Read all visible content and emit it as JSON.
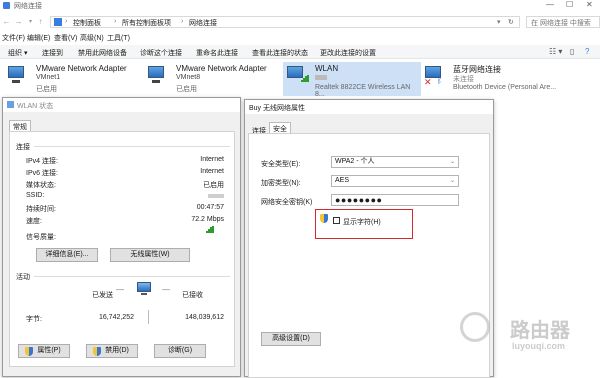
{
  "window": {
    "title": "网络连接"
  },
  "address": {
    "crumbs": [
      "控制面板",
      "所有控制面板项",
      "网络连接"
    ],
    "search_placeholder": "在 网络连接 中搜索"
  },
  "menu": [
    "文件(F)",
    "编辑(E)",
    "查看(V)",
    "高级(N)",
    "工具(T)"
  ],
  "commands": [
    "组织 ▾",
    "连接到",
    "禁用此网络设备",
    "诊断这个连接",
    "重命名此连接",
    "查看此连接的状态",
    "更改此连接的设置"
  ],
  "adapters": [
    {
      "name": "VMware Network Adapter",
      "sub": "VMnet1",
      "status": "已启用"
    },
    {
      "name": "VMware Network Adapter",
      "sub": "VMnet8",
      "status": "已启用"
    },
    {
      "name": "WLAN",
      "sub": "",
      "status": "Realtek 8822CE Wireless LAN 8..."
    },
    {
      "name": "蓝牙网络连接",
      "sub": "未连接",
      "status": "Bluetooth Device (Personal Are..."
    }
  ],
  "wlan_status": {
    "title": "WLAN 状态",
    "tab": "常规",
    "connection_header": "连接",
    "rows": [
      {
        "label": "IPv4 连接:",
        "value": "Internet"
      },
      {
        "label": "IPv6 连接:",
        "value": "Internet"
      },
      {
        "label": "媒体状态:",
        "value": "已启用"
      },
      {
        "label": "SSID:",
        "value": ""
      },
      {
        "label": "持续时间:",
        "value": "00:47:57"
      },
      {
        "label": "速度:",
        "value": "72.2 Mbps"
      },
      {
        "label": "信号质量:",
        "value": ""
      }
    ],
    "details_button": "详细信息(E)...",
    "wireless_props_button": "无线属性(W)",
    "activity_header": "活动",
    "sent_label": "已发送",
    "received_label": "已接收",
    "bytes_label": "字节:",
    "bytes_sent": "16,742,252",
    "bytes_received": "148,039,612",
    "properties_button": "属性(P)",
    "disable_button": "禁用(D)",
    "diagnose_button": "诊断(G)"
  },
  "wifi_props": {
    "title": "Buy 无线网络属性",
    "tabs": [
      "连接",
      "安全"
    ],
    "security_type_label": "安全类型(E):",
    "security_type_value": "WPA2 - 个人",
    "encryption_label": "加密类型(N):",
    "encryption_value": "AES",
    "key_label": "网络安全密钥(K)",
    "key_value": "●●●●●●●●",
    "show_chars_label": "显示字符(H)",
    "advanced_button": "高级设置(D)"
  },
  "watermark": {
    "name": "路由器",
    "url": "luyouqi.com"
  }
}
